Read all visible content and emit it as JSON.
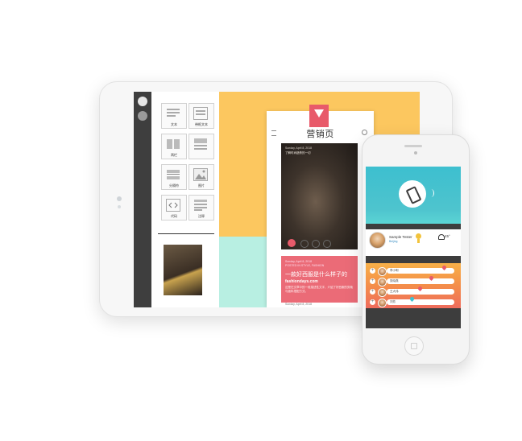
{
  "colors": {
    "canvas_yellow": "#fcc75f",
    "canvas_mint": "#b8efe2",
    "accent_pink": "#eb6b77",
    "hero_teal": "#3dbfcf",
    "list_orange": "#f48e4a"
  },
  "tablet": {
    "palette": {
      "tools": [
        {
          "label": "文本",
          "icon": "text-block-icon"
        },
        {
          "label": "带框文本",
          "icon": "framed-text-icon"
        },
        {
          "label": "两栏",
          "icon": "two-column-icon"
        },
        {
          "label": "",
          "icon": "text-list-icon"
        },
        {
          "label": "分隔符",
          "icon": "divider-icon"
        },
        {
          "label": "图片",
          "icon": "image-icon"
        },
        {
          "label": "代码",
          "icon": "code-icon"
        },
        {
          "label": "注释",
          "icon": "comment-icon"
        }
      ]
    },
    "page": {
      "title": "营销页",
      "post1": {
        "date": "Sunday, April 8, 2018",
        "text": "了解时尚趋势的一切"
      },
      "post2": {
        "date": "Sunday, April 8, 2018",
        "subtitle": "POSTED IN STYLE, FASHION",
        "title": "一款好西服是什么样子的",
        "site": "fashiondays.com",
        "body": "这是在文章中的一段描述性文字，介绍了好西服的剪裁与面料搭配方式。"
      },
      "post3": {
        "date": "Sunday, April 8, 2018"
      }
    }
  },
  "phone": {
    "profile": {
      "name": "Sample Tester",
      "location": "Beijing",
      "temperature": "45°"
    },
    "list": [
      {
        "name": "李小明",
        "pin_color": "#e85a6a"
      },
      {
        "name": "张晓燕",
        "pin_color": "#e85a6a"
      },
      {
        "name": "王大伟",
        "pin_color": "#e85a6a"
      },
      {
        "name": "刘芳",
        "pin_color": "#3dbfcf"
      }
    ]
  }
}
